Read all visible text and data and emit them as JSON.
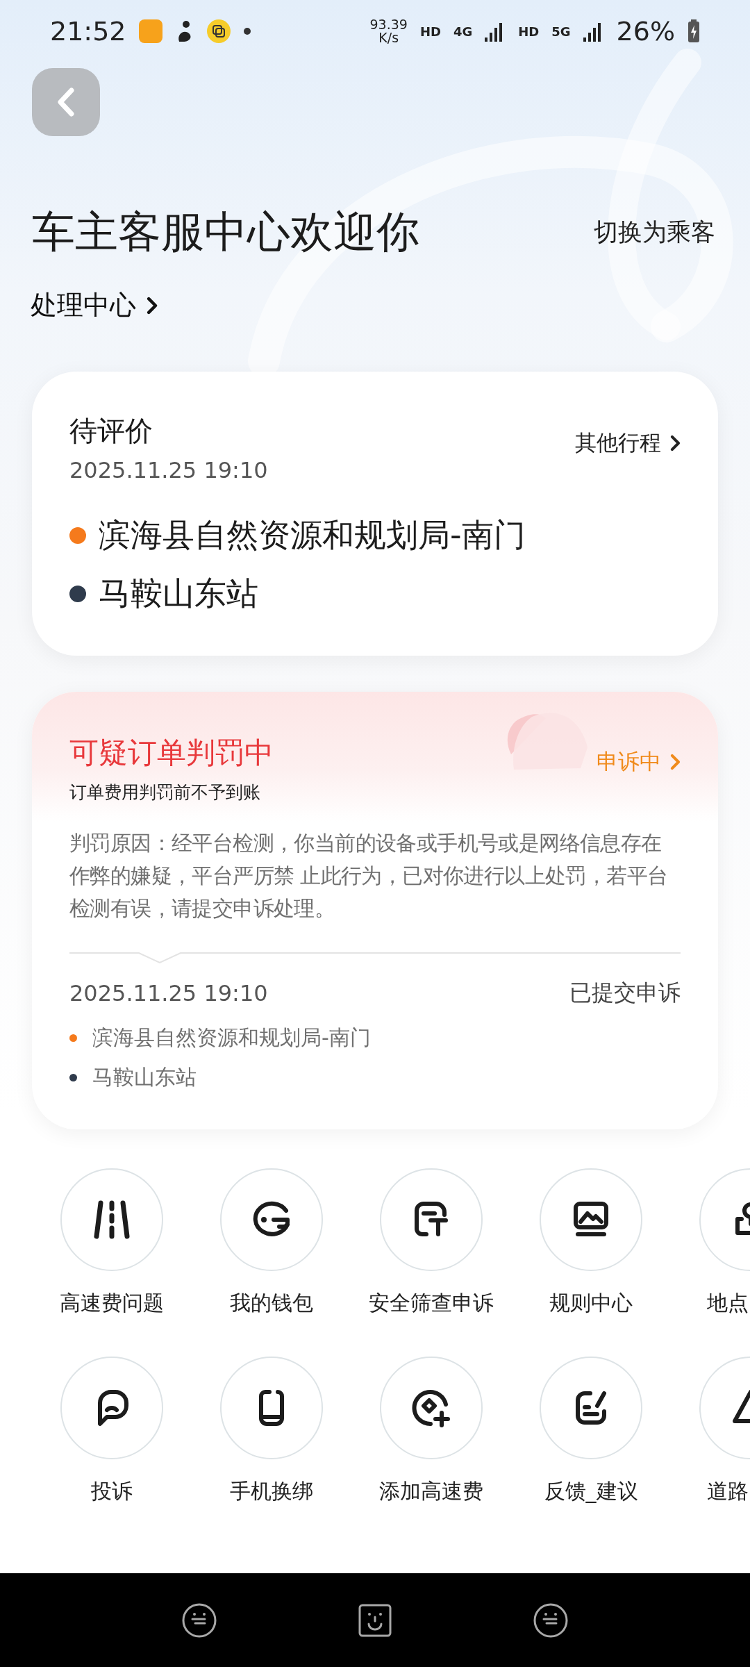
{
  "status_bar": {
    "time": "21:52",
    "network_speed": "93.39",
    "speed_unit": "K/s",
    "indicators": [
      "HD",
      "4G",
      "HD",
      "5G"
    ],
    "battery": "26%"
  },
  "header": {
    "title": "车主客服中心欢迎你",
    "switch_link": "切换为乘客",
    "processing_link": "处理中心"
  },
  "pending_card": {
    "title": "待评价",
    "time": "2025.11.25 19:10",
    "other_trips": "其他行程",
    "route": [
      {
        "name": "滨海县自然资源和规划局-南门",
        "color": "#f57a1c"
      },
      {
        "name": "马鞍山东站",
        "color": "#2f3b4c"
      }
    ]
  },
  "penalty_card": {
    "title": "可疑订单判罚中",
    "subtitle": "订单费用判罚前不予到账",
    "status": "申诉中",
    "reason": "判罚原因：经平台检测，你当前的设备或手机号或是网络信息存在作弊的嫌疑，平台严厉禁 止此行为，已对你进行以上处罚，若平台检测有误，请提交申诉处理。",
    "time": "2025.11.25 19:10",
    "appeal_status": "已提交申诉",
    "route": [
      {
        "name": "滨海县自然资源和规划局-南门",
        "color": "#f57a1c"
      },
      {
        "name": "马鞍山东站",
        "color": "#2f3b4c"
      }
    ]
  },
  "services": [
    {
      "label": "高速费问题"
    },
    {
      "label": "我的钱包"
    },
    {
      "label": "安全筛查申诉"
    },
    {
      "label": "规则中心"
    },
    {
      "label": "地点"
    },
    {
      "label": "投诉"
    },
    {
      "label": "手机换绑"
    },
    {
      "label": "添加高速费"
    },
    {
      "label": "反馈_建议"
    },
    {
      "label": "道路"
    }
  ]
}
